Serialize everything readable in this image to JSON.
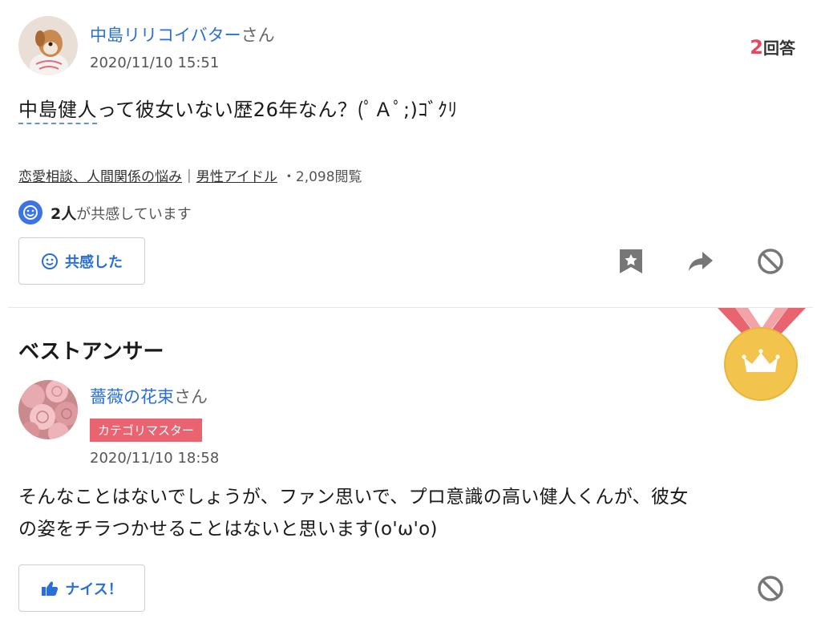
{
  "question": {
    "user_name": "中島リリコイバター",
    "user_suffix": "さん",
    "date": "2020/11/10 15:51",
    "answer_count_num": "2",
    "answer_count_label": "回答",
    "text_underlined": "中島健人",
    "text_rest": "って彼女いない歴26年なん？(ﾟＡﾟ;)ｺﾞｸﾘ",
    "category_1": "恋愛相談、人間関係の悩み",
    "category_sep": "|",
    "category_2": "男性アイドル",
    "views": "・2,098閲覧",
    "empathy_count": "2人",
    "empathy_suffix": "が共感しています",
    "empathy_button_label": "共感した"
  },
  "best_answer": {
    "section_title": "ベストアンサー",
    "user_name": "薔薇の花束",
    "user_suffix": "さん",
    "badge": "カテゴリマスター",
    "date": "2020/11/10 18:58",
    "text_line1": "そんなことはないでしょうが、ファン思いで、プロ意識の高い健人くんが、彼女",
    "text_line2": "の姿をチラつかせることはないと思います(o'ω'o)",
    "nice_button_label": "ナイス！"
  },
  "colors": {
    "link_blue": "#2a6fd6",
    "accent_red": "#e8485f",
    "badge_pink": "#e96470",
    "medal_gold": "#f2c44b"
  },
  "icons": [
    "empathy-smile-icon",
    "bookmark-icon",
    "share-icon",
    "block-icon",
    "thumbs-up-icon",
    "best-answer-medal-icon"
  ]
}
